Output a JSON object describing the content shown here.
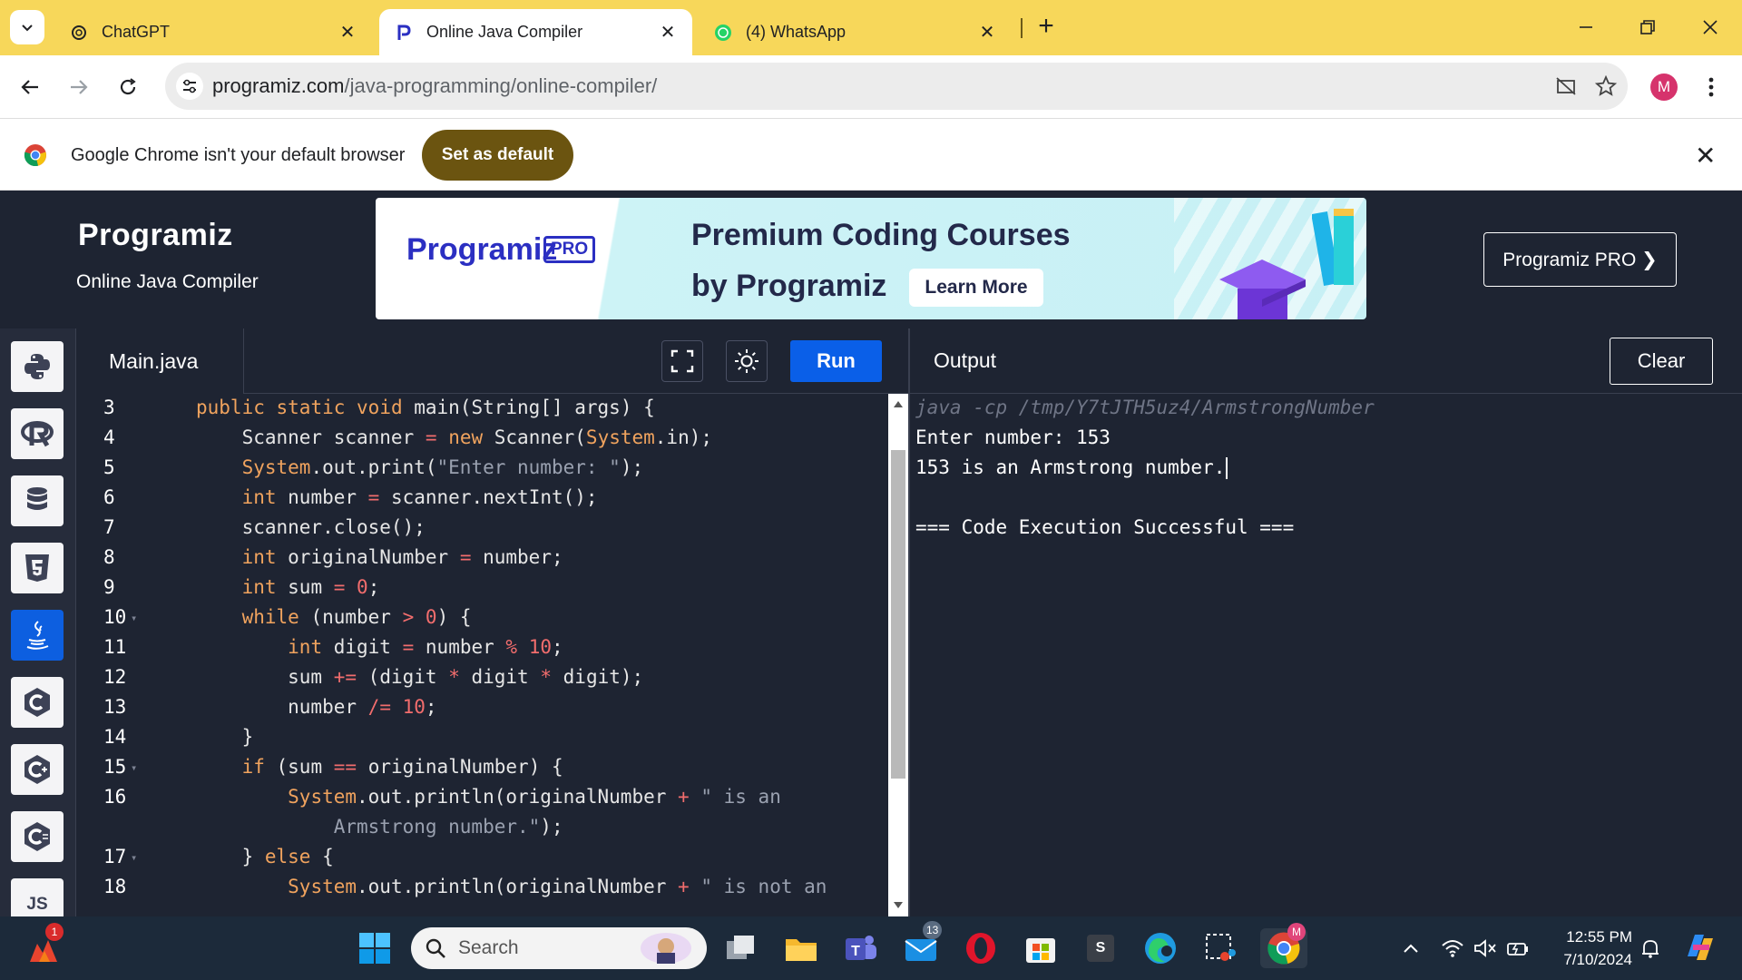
{
  "browser": {
    "tabs": [
      {
        "title": "ChatGPT",
        "active": false
      },
      {
        "title": "Online Java Compiler",
        "active": true
      },
      {
        "title": "(4) WhatsApp",
        "active": false
      }
    ],
    "new_tab": "+",
    "url_domain": "programiz.com",
    "url_path": "/java-programming/online-compiler/",
    "profile_initial": "M"
  },
  "infobar": {
    "message": "Google Chrome isn't your default browser",
    "button": "Set as default"
  },
  "header": {
    "logo": "Programiz",
    "subtitle": "Online Java Compiler",
    "banner": {
      "logo": "Programiz",
      "badge": "PRO",
      "title_line1": "Premium Coding Courses",
      "title_line2": "by Programiz",
      "cta": "Learn More"
    },
    "pro_button": "Programiz PRO ❯"
  },
  "sidebar": {
    "languages": [
      {
        "name": "python-icon",
        "active": false
      },
      {
        "name": "r-icon",
        "active": false
      },
      {
        "name": "sql-icon",
        "active": false
      },
      {
        "name": "html5-icon",
        "active": false
      },
      {
        "name": "java-icon",
        "active": true
      },
      {
        "name": "c-icon",
        "active": false
      },
      {
        "name": "cpp-icon",
        "active": false
      },
      {
        "name": "csharp-icon",
        "active": false
      },
      {
        "name": "js-icon",
        "active": false,
        "label": "JS"
      }
    ]
  },
  "editor": {
    "file_name": "Main.java",
    "run_label": "Run",
    "lines": [
      {
        "num": "3",
        "fold": true
      },
      {
        "num": "4",
        "fold": false
      },
      {
        "num": "5",
        "fold": false
      },
      {
        "num": "6",
        "fold": false
      },
      {
        "num": "7",
        "fold": false
      },
      {
        "num": "8",
        "fold": false
      },
      {
        "num": "9",
        "fold": false
      },
      {
        "num": "10",
        "fold": true
      },
      {
        "num": "11",
        "fold": false
      },
      {
        "num": "12",
        "fold": false
      },
      {
        "num": "13",
        "fold": false
      },
      {
        "num": "14",
        "fold": false
      },
      {
        "num": "15",
        "fold": true
      },
      {
        "num": "16",
        "fold": false
      },
      {
        "num": "",
        "fold": false
      },
      {
        "num": "17",
        "fold": true
      },
      {
        "num": "18",
        "fold": false
      }
    ],
    "code": [
      "public static void main(String[] args) {",
      "    Scanner scanner = new Scanner(System.in);",
      "    System.out.print(\"Enter number: \");",
      "    int number = scanner.nextInt();",
      "    scanner.close();",
      "    int originalNumber = number;",
      "    int sum = 0;",
      "    while (number > 0) {",
      "        int digit = number % 10;",
      "        sum += (digit * digit * digit);",
      "        number /= 10;",
      "    }",
      "    if (sum == originalNumber) {",
      "        System.out.println(originalNumber + \" is an",
      "            Armstrong number.\");",
      "    } else {",
      "        System.out.println(originalNumber + \" is not an"
    ]
  },
  "output": {
    "title": "Output",
    "clear_label": "Clear",
    "command": "java -cp /tmp/Y7tJTH5uz4/ArmstrongNumber",
    "lines": [
      "Enter number: 153",
      "153 is an Armstrong number.",
      "",
      "=== Code Execution Successful ==="
    ]
  },
  "taskbar": {
    "search_placeholder": "Search",
    "notification_badge": "1",
    "mail_badge": "13",
    "store_letter": "S",
    "time": "12:55 PM",
    "date": "7/10/2024"
  }
}
